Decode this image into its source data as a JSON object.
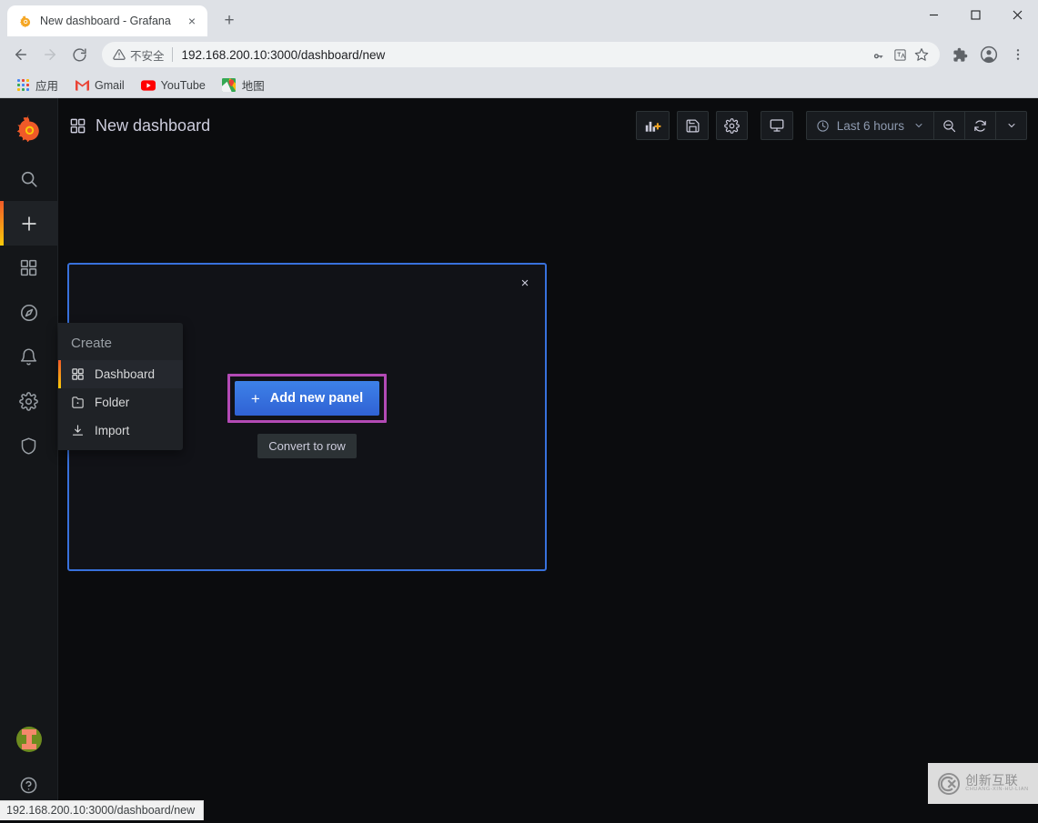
{
  "browser": {
    "tab": {
      "title": "New dashboard - Grafana",
      "favicon_name": "grafana-favicon",
      "close_label": "×"
    },
    "new_tab_label": "+",
    "window_controls": {
      "minimize": "minimize-icon",
      "maximize": "maximize-icon",
      "close": "close-icon"
    },
    "nav": {
      "back": "back-arrow-icon",
      "forward": "forward-arrow-icon",
      "reload": "reload-icon"
    },
    "omnibox": {
      "security_label": "不安全",
      "url": "192.168.200.10:3000/dashboard/new",
      "icons": [
        "key-icon",
        "translate-icon",
        "bookmark-star-icon"
      ]
    },
    "toolbar_right": [
      "extensions-puzzle-icon",
      "profile-avatar-icon",
      "chrome-menu-icon"
    ],
    "bookmarks": [
      {
        "label": "应用",
        "icon": "apps-grid-icon"
      },
      {
        "label": "Gmail",
        "icon": "gmail-icon"
      },
      {
        "label": "YouTube",
        "icon": "youtube-icon"
      },
      {
        "label": "地图",
        "icon": "maps-icon"
      }
    ]
  },
  "sidebar": {
    "logo_name": "grafana-logo",
    "top_items": [
      {
        "name": "search",
        "icon": "search-icon",
        "active": false
      },
      {
        "name": "create",
        "icon": "plus-icon",
        "active": true
      },
      {
        "name": "dashboards",
        "icon": "dashboards-grid-icon",
        "active": false
      },
      {
        "name": "explore",
        "icon": "compass-icon",
        "active": false
      },
      {
        "name": "alerting",
        "icon": "bell-icon",
        "active": false
      },
      {
        "name": "configuration",
        "icon": "gear-icon",
        "active": false
      },
      {
        "name": "server-admin",
        "icon": "shield-icon",
        "active": false
      }
    ],
    "bottom_items": [
      {
        "name": "user-avatar",
        "icon": "avatar-icon"
      },
      {
        "name": "help",
        "icon": "question-circle-icon"
      }
    ]
  },
  "create_menu": {
    "heading": "Create",
    "items": [
      {
        "label": "Dashboard",
        "icon": "dashboard-grid-icon",
        "active": true
      },
      {
        "label": "Folder",
        "icon": "folder-plus-icon",
        "active": false
      },
      {
        "label": "Import",
        "icon": "import-download-icon",
        "active": false
      }
    ]
  },
  "dashboard": {
    "title": "New dashboard",
    "title_icon": "dashboard-grid-icon",
    "toolbar": {
      "add_panel": {
        "label": "",
        "icon": "add-panel-icon"
      },
      "save": {
        "label": "",
        "icon": "save-floppy-icon"
      },
      "settings": {
        "label": "",
        "icon": "gear-icon"
      },
      "tv_mode": {
        "label": "",
        "icon": "monitor-icon"
      },
      "time_range": {
        "label": "Last 6 hours",
        "icon": "clock-icon",
        "caret": "chevron-down-icon"
      },
      "zoom_out": {
        "label": "",
        "icon": "zoom-out-icon"
      },
      "refresh": {
        "label": "",
        "icon": "refresh-icon"
      },
      "refresh_interval": {
        "label": "",
        "icon": "chevron-down-icon"
      }
    },
    "panel": {
      "close_label": "×",
      "add_new_panel_label": "Add new panel",
      "add_new_panel_plus": "+",
      "convert_to_row_label": "Convert to row",
      "highlight_color": "#b34ab5",
      "border_color": "#3871dc"
    }
  },
  "status_bar": {
    "url": "192.168.200.10:3000/dashboard/new"
  },
  "watermark": {
    "cn": "创新互联",
    "en": "CHUANG-XIN-HU-LIAN",
    "logo": "cx-logo-icon"
  }
}
